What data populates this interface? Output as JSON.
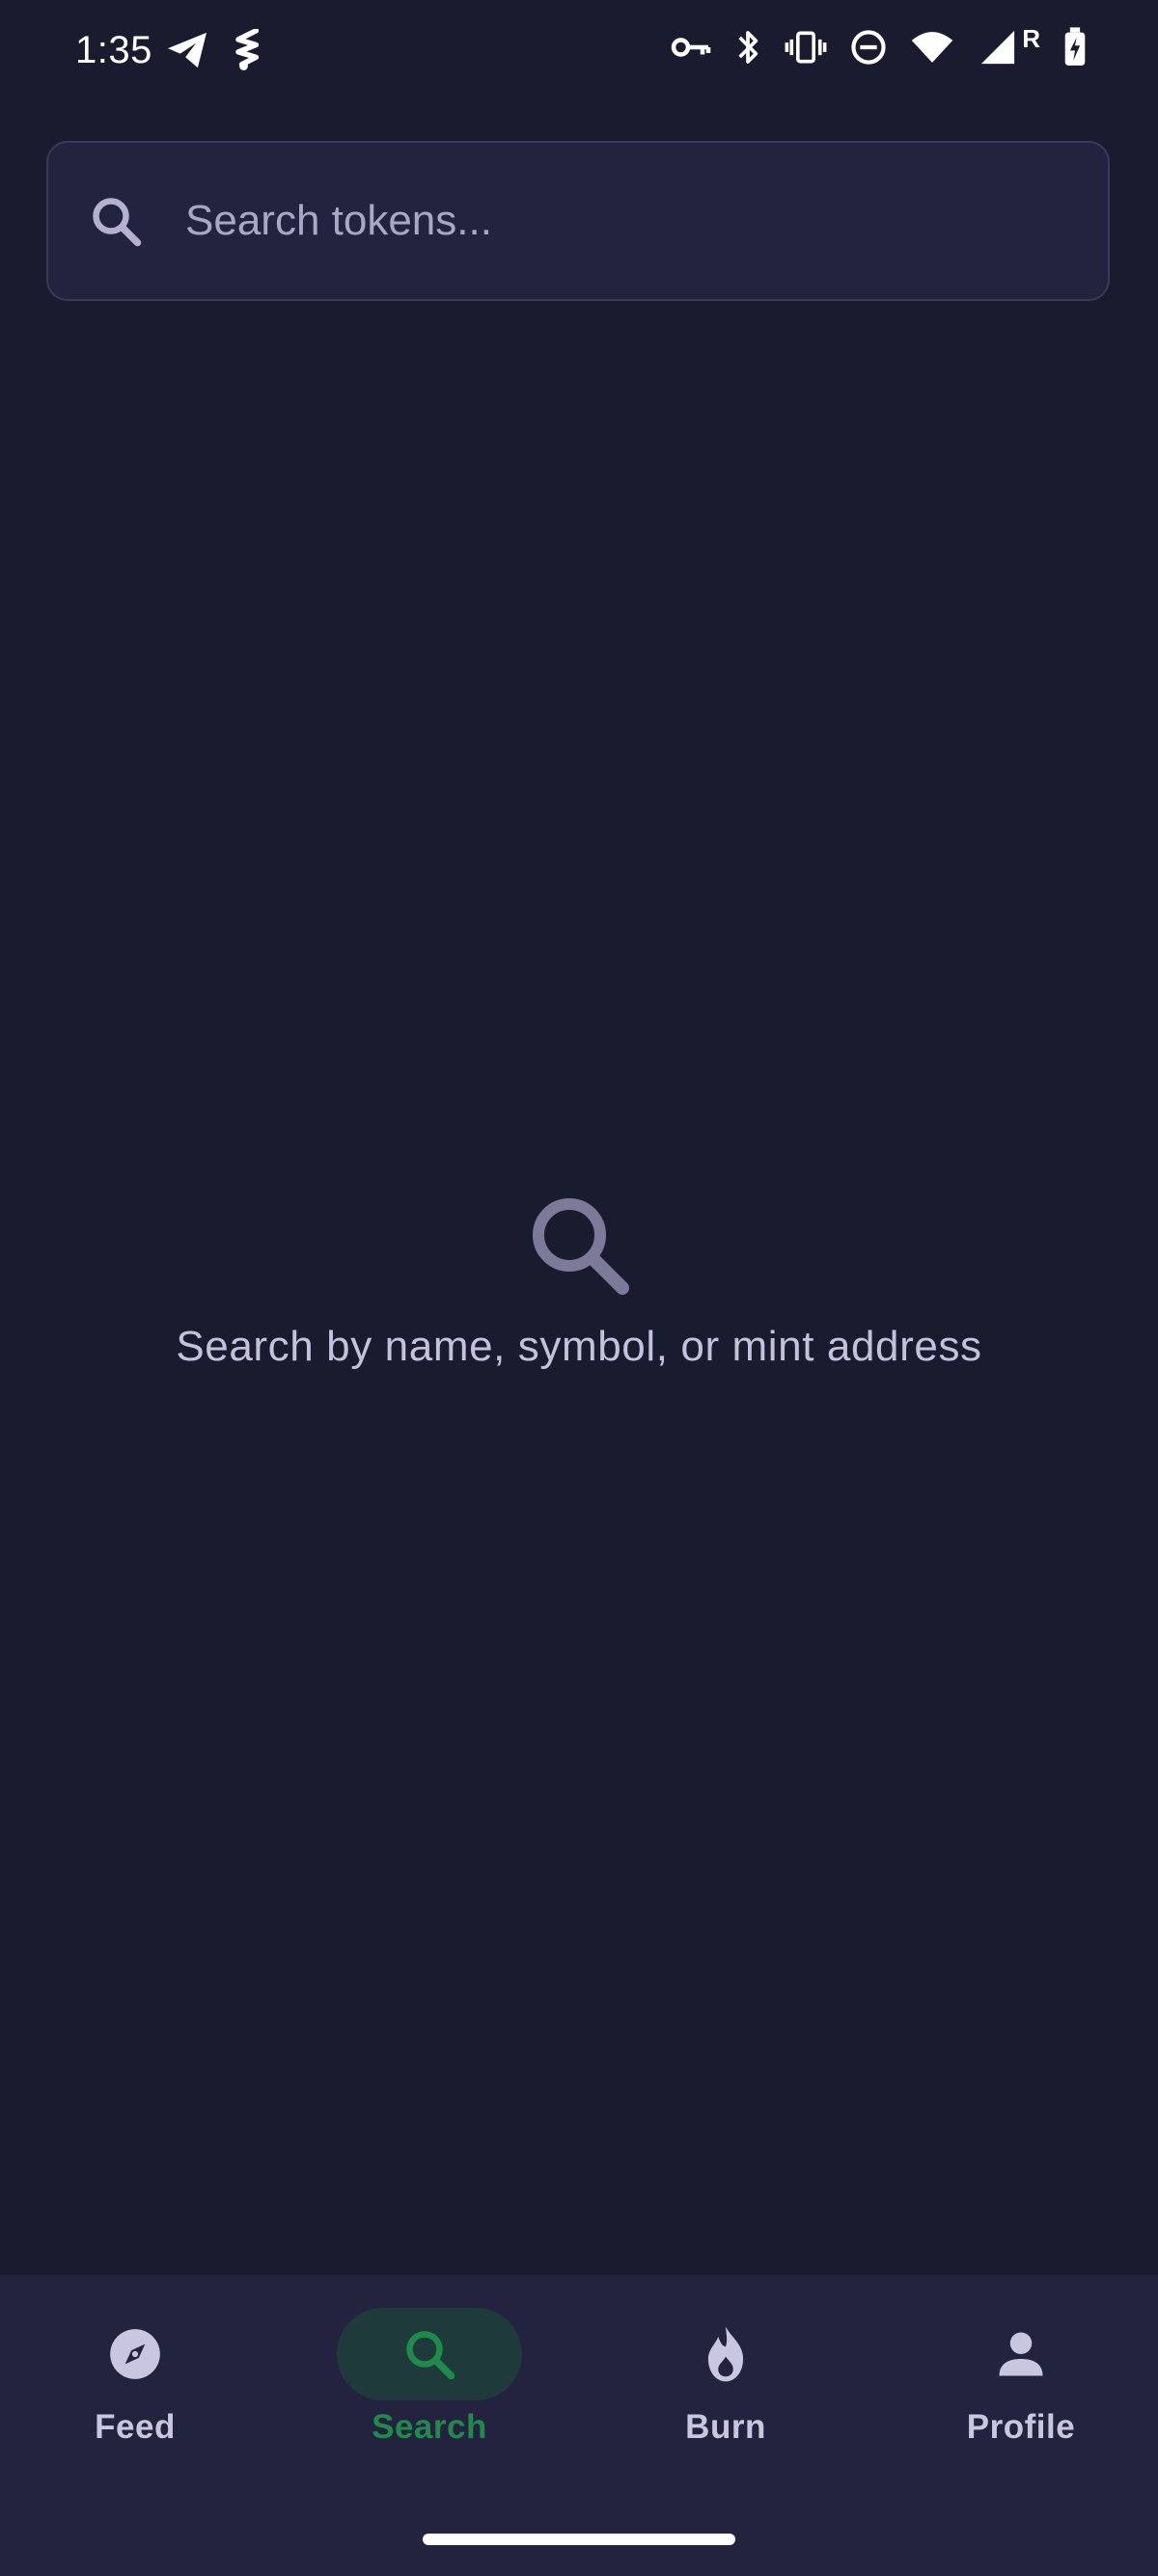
{
  "status_bar": {
    "time": "1:35",
    "left_icons": [
      "telegram-icon",
      "app-notification-icon"
    ],
    "right_icons": [
      "vpn-key-icon",
      "bluetooth-icon",
      "vibrate-icon",
      "do-not-disturb-icon",
      "wifi-icon",
      "signal-icon",
      "battery-charging-icon"
    ],
    "roaming_indicator": "R"
  },
  "search": {
    "placeholder": "Search tokens...",
    "value": "",
    "icon": "search-icon"
  },
  "empty_state": {
    "icon": "search-icon",
    "message": "Search by name, symbol, or mint address"
  },
  "bottom_nav": {
    "items": [
      {
        "label": "Feed",
        "icon": "compass-icon",
        "active": false
      },
      {
        "label": "Search",
        "icon": "search-icon",
        "active": true
      },
      {
        "label": "Burn",
        "icon": "flame-icon",
        "active": false
      },
      {
        "label": "Profile",
        "icon": "person-icon",
        "active": false
      }
    ]
  },
  "colors": {
    "background": "#1b1b2f",
    "surface": "#24233f",
    "accent": "#1f8a4a",
    "accent_pill": "#1f3a3a",
    "text_muted": "#c3c1dc",
    "icon_muted": "#7d7a99"
  }
}
